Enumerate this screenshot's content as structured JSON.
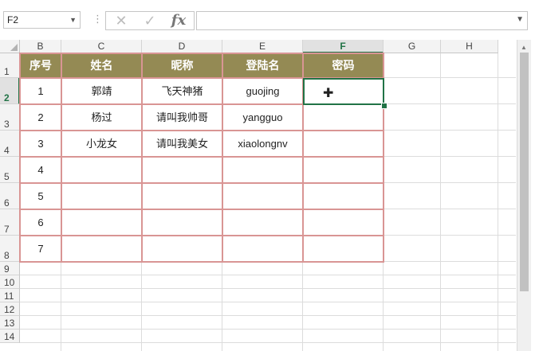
{
  "formula_bar": {
    "name_box": "F2",
    "cancel_icon": "✕",
    "enter_icon": "✓",
    "fx_label": "fx",
    "formula": ""
  },
  "columns": [
    "B",
    "C",
    "D",
    "E",
    "F",
    "G",
    "H"
  ],
  "selected_column": "F",
  "rows": [
    "1",
    "2",
    "3",
    "4",
    "5",
    "6",
    "7",
    "8",
    "9",
    "10",
    "11",
    "12",
    "13",
    "14"
  ],
  "selected_row": "2",
  "table": {
    "headers": [
      "序号",
      "姓名",
      "昵称",
      "登陆名",
      "密码"
    ],
    "rows": [
      [
        "1",
        "郭靖",
        "飞天神猪",
        "guojing",
        ""
      ],
      [
        "2",
        "杨过",
        "请叫我帅哥",
        "yangguo",
        ""
      ],
      [
        "3",
        "小龙女",
        "请叫我美女",
        "xiaolongnv",
        ""
      ],
      [
        "4",
        "",
        "",
        "",
        ""
      ],
      [
        "5",
        "",
        "",
        "",
        ""
      ],
      [
        "6",
        "",
        "",
        "",
        ""
      ],
      [
        "7",
        "",
        "",
        "",
        ""
      ]
    ]
  },
  "active_cell": "F2",
  "colors": {
    "header_fill": "#948a54",
    "border": "#d99594",
    "selection": "#217346"
  }
}
